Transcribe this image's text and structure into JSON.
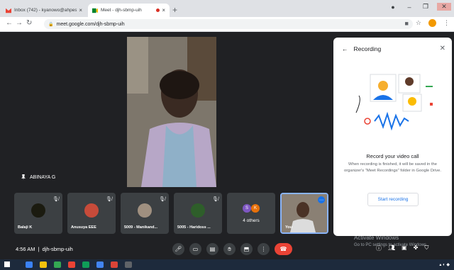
{
  "browser": {
    "tabs": [
      {
        "title": "Inbox (742) - kyanowo@ahpesb ...",
        "icon": "gmail-icon",
        "active": false
      },
      {
        "title": "Meet - djh-sbmp-uih",
        "icon": "meet-icon",
        "active": true
      }
    ],
    "new_tab": "+",
    "url": "meet.google.com/djh-sbmp-uih",
    "window_controls": {
      "minimize": "–",
      "maximize": "❐",
      "close": "✕"
    }
  },
  "meet": {
    "speaker_name": "ABINAYA G",
    "tiles": [
      {
        "name": "Balaji K"
      },
      {
        "name": "Anusuya EEE"
      },
      {
        "name": "5009 - Manikand..."
      },
      {
        "name": "5005 - Haridoss ..."
      },
      {
        "name": "4 others",
        "bubbles": [
          "S",
          "K"
        ]
      },
      {
        "name": "You"
      }
    ],
    "time": "4:56 AM",
    "meeting_code": "djh-sbmp-uih",
    "separator": "|"
  },
  "recording_panel": {
    "title": "Recording",
    "heading": "Record your video call",
    "description": "When recording is finished, it will be saved in the organizer's \"Meet Recordings\" folder in Google Drive.",
    "start_button": "Start recording"
  },
  "watermark": {
    "line1": "Activate Windows",
    "line2": "Go to PC settings to activate Windows."
  },
  "colors": {
    "meet_bg": "#202124",
    "tile_bg": "#3c4043",
    "end_call": "#ea4335",
    "accent_blue": "#1a73e8"
  }
}
